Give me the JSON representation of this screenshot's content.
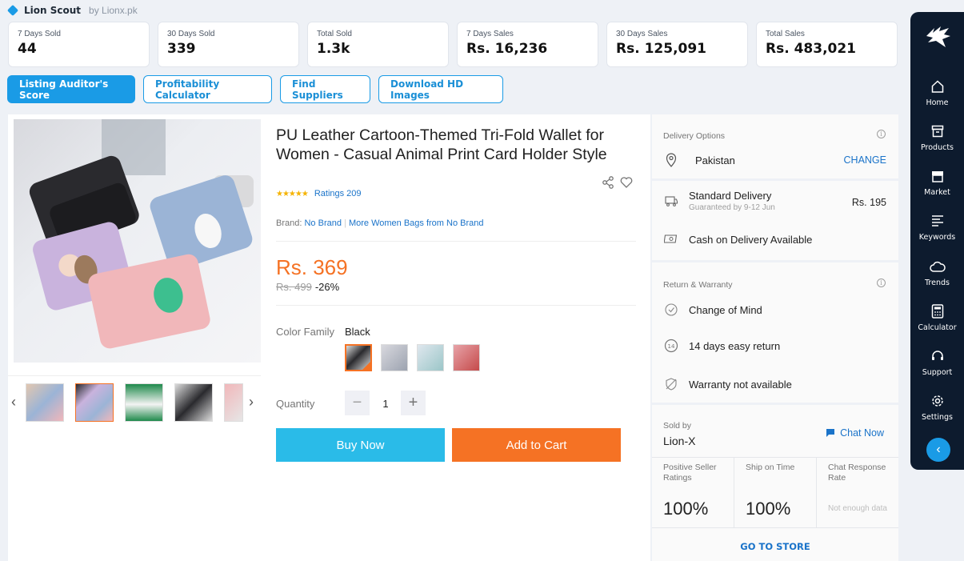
{
  "header": {
    "brand": "Lion Scout",
    "by": "by Lionx.pk",
    "accent": "#1a9be6"
  },
  "stats": [
    {
      "label": "7 Days Sold",
      "value": "44"
    },
    {
      "label": "30 Days Sold",
      "value": "339"
    },
    {
      "label": "Total Sold",
      "value": "1.3k"
    },
    {
      "label": "7 Days Sales",
      "value": "Rs. 16,236"
    },
    {
      "label": "30 Days Sales",
      "value": "Rs. 125,091"
    },
    {
      "label": "Total Sales",
      "value": "Rs. 483,021"
    }
  ],
  "actions": {
    "auditor": "Listing Auditor's Score",
    "profit": "Profitability Calculator",
    "suppliers": "Find Suppliers",
    "images": "Download HD Images"
  },
  "product": {
    "title": "PU Leather Cartoon-Themed Tri-Fold Wallet for Women - Casual Animal Print Card Holder Style",
    "ratings": "Ratings 209",
    "brand_label": "Brand:",
    "brand": "No Brand",
    "more": "More Women Bags from No Brand",
    "price": "Rs. 369",
    "old_price": "Rs. 499",
    "discount": "-26%",
    "color_label": "Color Family",
    "color_value": "Black",
    "qty_label": "Quantity",
    "qty": "1",
    "buy": "Buy Now",
    "cart": "Add to Cart",
    "price_color": "#f57224"
  },
  "delivery": {
    "header": "Delivery Options",
    "location": "Pakistan",
    "change": "CHANGE",
    "standard": "Standard Delivery",
    "guarantee": "Guaranteed by 9-12 Jun",
    "standard_price": "Rs. 195",
    "cod": "Cash on Delivery Available"
  },
  "warranty": {
    "header": "Return & Warranty",
    "change_mind": "Change of Mind",
    "return": "14 days easy return",
    "warranty": "Warranty not available"
  },
  "seller": {
    "sold_by": "Sold by",
    "name": "Lion-X",
    "chat": "Chat Now",
    "m1_label": "Positive Seller Ratings",
    "m1_value": "100%",
    "m2_label": "Ship on Time",
    "m2_value": "100%",
    "m3_label": "Chat Response Rate",
    "m3_value": "Not enough data",
    "go_store": "GO TO STORE"
  },
  "nav": {
    "home": "Home",
    "products": "Products",
    "market": "Market",
    "keywords": "Keywords",
    "trends": "Trends",
    "calculator": "Calculator",
    "support": "Support",
    "settings": "Settings"
  }
}
